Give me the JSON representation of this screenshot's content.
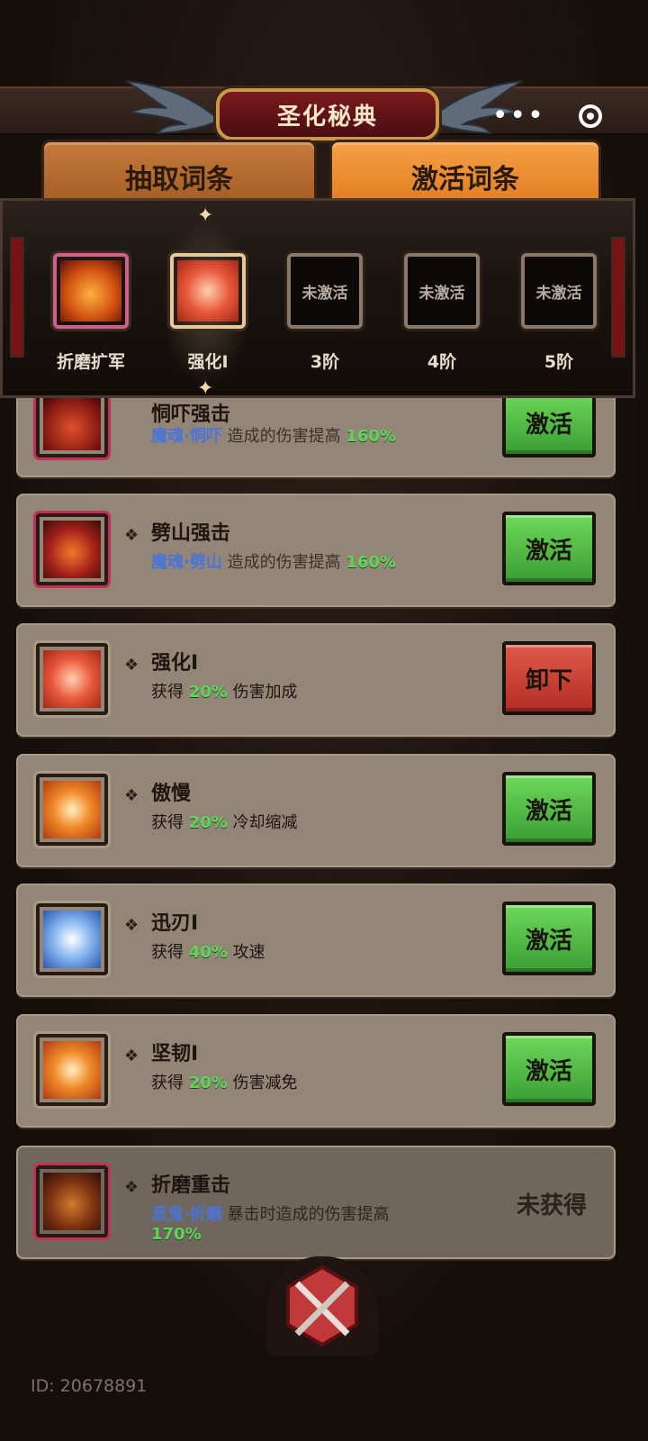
{
  "header": {
    "title": "圣化秘典",
    "more_label": "•••"
  },
  "tabs": [
    {
      "label": "抽取词条",
      "active": false
    },
    {
      "label": "激活词条",
      "active": true
    }
  ],
  "slots": [
    {
      "label": "折磨扩军",
      "state": "filled"
    },
    {
      "label": "强化I",
      "state": "selected"
    },
    {
      "label": "3阶",
      "state": "empty",
      "text": "未激活"
    },
    {
      "label": "4阶",
      "state": "empty",
      "text": "未激活"
    },
    {
      "label": "5阶",
      "state": "empty",
      "text": "未激活"
    }
  ],
  "items": [
    {
      "name": "恫吓强击",
      "tag": "魔魂·恫吓",
      "desc": "造成的伤害提高",
      "pct": "160%",
      "action": "激活"
    },
    {
      "name": "劈山强击",
      "tag": "魔魂·劈山",
      "desc": "造成的伤害提高",
      "pct": "160%",
      "action": "激活"
    },
    {
      "name": "强化I",
      "prefix": "获得",
      "pct": "20%",
      "desc": "伤害加成",
      "action": "卸下"
    },
    {
      "name": "傲慢",
      "prefix": "获得",
      "pct": "20%",
      "desc": "冷却缩减",
      "action": "激活"
    },
    {
      "name": "迅刃I",
      "prefix": "获得",
      "pct": "40%",
      "desc": "攻速",
      "action": "激活"
    },
    {
      "name": "坚韧I",
      "prefix": "获得",
      "pct": "20%",
      "desc": "伤害减免",
      "action": "激活"
    },
    {
      "name": "折磨重击",
      "tag": "恶鬼·折磨",
      "desc": "暴击时造成的伤害提高",
      "pct": "170%",
      "status": "未获得"
    }
  ],
  "footer": {
    "id_text": "ID: 20678891"
  },
  "colors": {
    "accent_orange": "#e07a1f",
    "button_green": "#3a9e34",
    "button_red": "#b32c24",
    "percent_green": "#5fd65a",
    "tag_blue": "#4a74d8"
  }
}
